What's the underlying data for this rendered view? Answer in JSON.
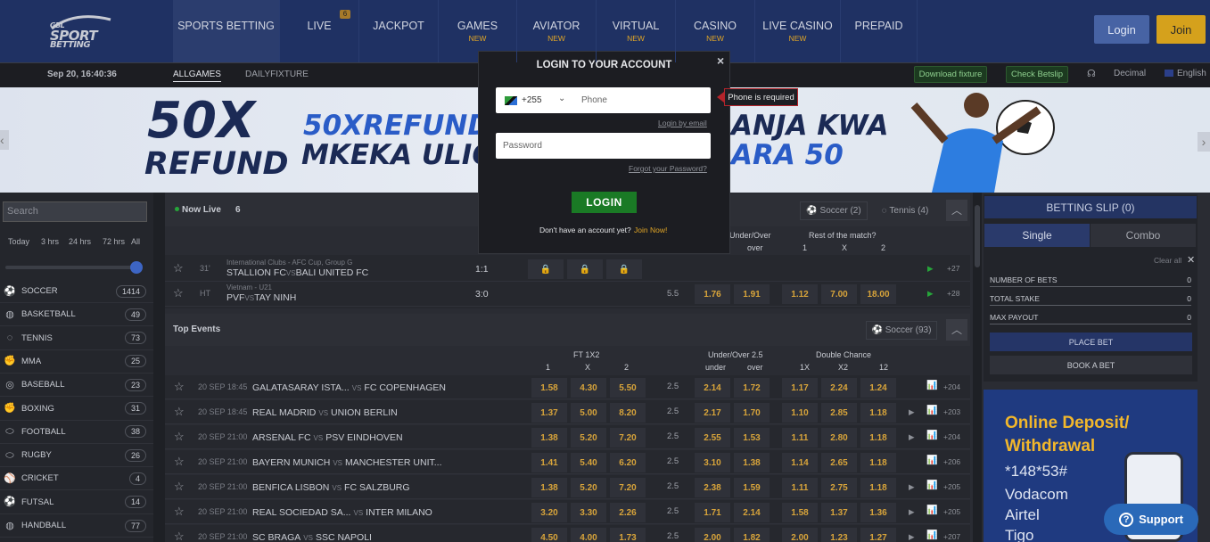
{
  "nav": {
    "logo_small": "GBL",
    "logo_line1": "SPORT",
    "logo_line2": "BETTING",
    "items": [
      {
        "label": "SPORTS BETTING",
        "sub": ""
      },
      {
        "label": "LIVE",
        "sub": ""
      },
      {
        "label": "JACKPOT",
        "sub": ""
      },
      {
        "label": "GAMES",
        "sub": "NEW"
      },
      {
        "label": "AVIATOR",
        "sub": "NEW"
      },
      {
        "label": "VIRTUAL",
        "sub": "NEW"
      },
      {
        "label": "CASINO",
        "sub": "NEW"
      },
      {
        "label": "LIVE CASINO",
        "sub": "NEW"
      },
      {
        "label": "PREPAID",
        "sub": ""
      }
    ],
    "live_badge": "6",
    "login": "Login",
    "join": "Join"
  },
  "subbar": {
    "datetime": "Sep 20, 16:40:36",
    "tab_all": "ALLGAMES",
    "tab_daily": "DAILYFIXTURE",
    "download": "Download fixture",
    "check": "Check Betslip",
    "odds_format": "Decimal",
    "language": "English"
  },
  "banner": {
    "big1": "50X",
    "big2": "REFUND",
    "mid1": "50XREFUND",
    "mid2": "MKEKA ULIO",
    "right1": "ANJA KWA",
    "right2": "ARA 50"
  },
  "sidebar": {
    "search_placeholder": "Search",
    "time_filters": [
      "Today",
      "3 hrs",
      "24 hrs",
      "72 hrs",
      "All"
    ],
    "sports": [
      {
        "name": "SOCCER",
        "count": "1414",
        "icon": "⚽"
      },
      {
        "name": "BASKETBALL",
        "count": "49",
        "icon": "◍"
      },
      {
        "name": "TENNIS",
        "count": "73",
        "icon": "◌"
      },
      {
        "name": "MMA",
        "count": "25",
        "icon": "✊"
      },
      {
        "name": "BASEBALL",
        "count": "23",
        "icon": "◎"
      },
      {
        "name": "BOXING",
        "count": "31",
        "icon": "✊"
      },
      {
        "name": "FOOTBALL",
        "count": "38",
        "icon": "⬭"
      },
      {
        "name": "RUGBY",
        "count": "26",
        "icon": "⬭"
      },
      {
        "name": "CRICKET",
        "count": "4",
        "icon": "⚾"
      },
      {
        "name": "FUTSAL",
        "count": "14",
        "icon": "⚽"
      },
      {
        "name": "HANDBALL",
        "count": "77",
        "icon": "◍"
      }
    ]
  },
  "live": {
    "title": "Now Live",
    "count": "6",
    "tab_soccer": "Soccer (2)",
    "tab_tennis": "Tennis (4)",
    "col_uo": "Under/Over",
    "col_rest": "Rest of the match?",
    "sub_over": "over",
    "sub_1": "1",
    "sub_x": "X",
    "sub_2": "2",
    "rows": [
      {
        "min": "31'",
        "league": "International Clubs - AFC Cup, Group G",
        "home": "STALLION FC",
        "away": "BALI UNITED FC",
        "score": "1:1",
        "line": "",
        "o1": "",
        "o2": "",
        "r1": "",
        "rx": "",
        "r2": "",
        "more": "+27"
      },
      {
        "min": "HT",
        "league": "Vietnam - U21",
        "home": "PVF",
        "away": "TAY NINH",
        "score": "3:0",
        "line": "5.5",
        "o1": "1.76",
        "o2": "1.91",
        "r1": "1.12",
        "rx": "7.00",
        "r2": "18.00",
        "more": "+28"
      }
    ]
  },
  "top": {
    "title": "Top Events",
    "tab": "Soccer (93)",
    "h_1x2": "FT 1X2",
    "h_uo": "Under/Over 2.5",
    "h_dc": "Double Chance",
    "s1": "1",
    "sx": "X",
    "s2": "2",
    "su": "under",
    "so": "over",
    "s1x": "1X",
    "sx2": "X2",
    "s12": "12",
    "vs": "VS",
    "rows": [
      {
        "time": "20 SEP 18:45",
        "home": "GALATASARAY ISTA...",
        "away": "FC COPENHAGEN",
        "o": [
          "1.58",
          "4.30",
          "5.50"
        ],
        "line": "2.5",
        "uo": [
          "2.14",
          "1.72"
        ],
        "dc": [
          "1.17",
          "2.24",
          "1.24"
        ],
        "more": "+204",
        "play": false
      },
      {
        "time": "20 SEP 18:45",
        "home": "REAL MADRID",
        "away": "UNION BERLIN",
        "o": [
          "1.37",
          "5.00",
          "8.20"
        ],
        "line": "2.5",
        "uo": [
          "2.17",
          "1.70"
        ],
        "dc": [
          "1.10",
          "2.85",
          "1.18"
        ],
        "more": "+203",
        "play": true
      },
      {
        "time": "20 SEP 21:00",
        "home": "ARSENAL FC",
        "away": "PSV EINDHOVEN",
        "o": [
          "1.38",
          "5.20",
          "7.20"
        ],
        "line": "2.5",
        "uo": [
          "2.55",
          "1.53"
        ],
        "dc": [
          "1.11",
          "2.80",
          "1.18"
        ],
        "more": "+204",
        "play": true
      },
      {
        "time": "20 SEP 21:00",
        "home": "BAYERN MUNICH",
        "away": "MANCHESTER UNIT...",
        "o": [
          "1.41",
          "5.40",
          "6.20"
        ],
        "line": "2.5",
        "uo": [
          "3.10",
          "1.38"
        ],
        "dc": [
          "1.14",
          "2.65",
          "1.18"
        ],
        "more": "+206",
        "play": false
      },
      {
        "time": "20 SEP 21:00",
        "home": "BENFICA LISBON",
        "away": "FC SALZBURG",
        "o": [
          "1.38",
          "5.20",
          "7.20"
        ],
        "line": "2.5",
        "uo": [
          "2.38",
          "1.59"
        ],
        "dc": [
          "1.11",
          "2.75",
          "1.18"
        ],
        "more": "+205",
        "play": true
      },
      {
        "time": "20 SEP 21:00",
        "home": "REAL SOCIEDAD SA...",
        "away": "INTER MILANO",
        "o": [
          "3.20",
          "3.30",
          "2.26"
        ],
        "line": "2.5",
        "uo": [
          "1.71",
          "2.14"
        ],
        "dc": [
          "1.58",
          "1.37",
          "1.36"
        ],
        "more": "+205",
        "play": true
      },
      {
        "time": "20 SEP 21:00",
        "home": "SC BRAGA",
        "away": "SSC NAPOLI",
        "o": [
          "4.50",
          "4.00",
          "1.73"
        ],
        "line": "2.5",
        "uo": [
          "2.00",
          "1.82"
        ],
        "dc": [
          "2.00",
          "1.23",
          "1.27"
        ],
        "more": "+207",
        "play": true
      }
    ]
  },
  "betslip": {
    "title": "BETTING SLIP (0)",
    "single": "Single",
    "combo": "Combo",
    "clear": "Clear all",
    "rows": [
      {
        "label": "NUMBER OF BETS",
        "val": "0"
      },
      {
        "label": "TOTAL STAKE",
        "val": "0"
      },
      {
        "label": "MAX PAYOUT",
        "val": "0"
      }
    ],
    "place": "PLACE BET",
    "book": "BOOK A BET"
  },
  "ad": {
    "l1": "Online Deposit/",
    "l2": "Withdrawal",
    "code": "*148*53#",
    "n1": "Vodacom",
    "n2": "Airtel",
    "n3": "Tigo"
  },
  "modal": {
    "title": "LOGIN TO YOUR ACCOUNT",
    "close": "×",
    "code": "+255",
    "phone_ph": "Phone",
    "login_email": "Login by email",
    "password_ph": "Password",
    "forgot": "Forgot your Password?",
    "login_btn": "LOGIN",
    "no_account": "Don't have an account yet?",
    "join_now": "Join Now!"
  },
  "tooltip": "Phone is required",
  "support": "Support"
}
